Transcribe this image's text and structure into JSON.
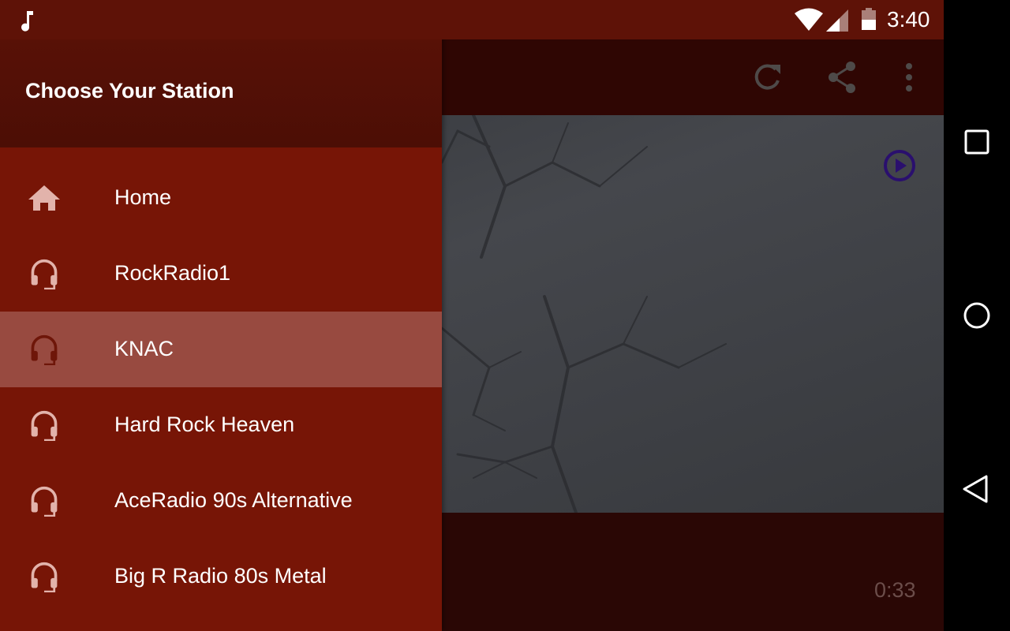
{
  "status_bar": {
    "time": "3:40",
    "icons": [
      "music-note-icon",
      "wifi-icon",
      "cell-signal-icon",
      "battery-icon"
    ]
  },
  "drawer": {
    "title": "Choose Your Station",
    "items": [
      {
        "label": "Home",
        "icon": "home-icon",
        "selected": false
      },
      {
        "label": "RockRadio1",
        "icon": "headphones-icon",
        "selected": false
      },
      {
        "label": "KNAC",
        "icon": "headphones-icon",
        "selected": true
      },
      {
        "label": "Hard Rock Heaven",
        "icon": "headphones-icon",
        "selected": false
      },
      {
        "label": "AceRadio 90s Alternative",
        "icon": "headphones-icon",
        "selected": false
      },
      {
        "label": "Big R Radio 80s Metal",
        "icon": "headphones-icon",
        "selected": false
      }
    ]
  },
  "toolbar": {
    "icons": [
      "refresh-icon",
      "share-icon",
      "more-vert-icon"
    ]
  },
  "player": {
    "elapsed": "0:33",
    "play_icon": "play-circle-icon"
  },
  "nav_bar": {
    "icons": [
      "recents-icon",
      "home-circle-icon",
      "back-icon"
    ]
  },
  "colors": {
    "drawer_bg": "#771506",
    "drawer_header": "#5c1207",
    "status_bar": "#5e1207",
    "selected_row": "#984a40",
    "toolbar": "#2f0603",
    "play_accent": "#2a0f6e"
  }
}
